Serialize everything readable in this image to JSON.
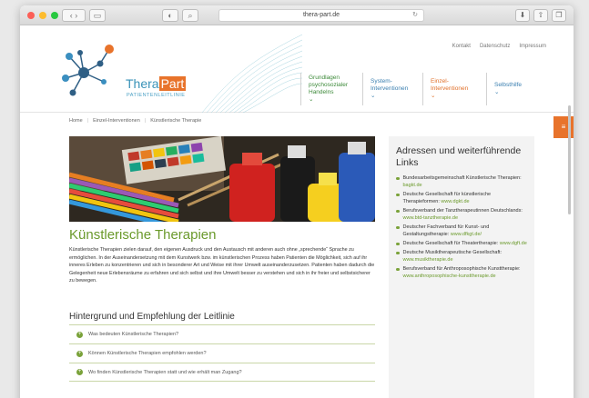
{
  "browser": {
    "url": "thera-part.de"
  },
  "logo": {
    "brand_prefix": "Thera",
    "brand_suffix": "Part",
    "tagline": "PATIENTENLEITLINIE"
  },
  "meta_nav": [
    "Kontakt",
    "Datenschutz",
    "Impressum"
  ],
  "main_nav": [
    {
      "label": "Grundlagen psychosozialer Handelns",
      "color": "green"
    },
    {
      "label": "System-Interventionen",
      "color": "blue"
    },
    {
      "label": "Einzel-Interventionen",
      "color": "orange"
    },
    {
      "label": "Selbsthilfe",
      "color": "blue"
    }
  ],
  "breadcrumb": [
    "Home",
    "Einzel-Interventionen",
    "Künstlerische Therapie"
  ],
  "main": {
    "title": "Künstlerische Therapien",
    "intro": "Künstlerische Therapien zielen darauf, den eigenen Ausdruck und den Austausch mit anderen auch ohne „sprechende“ Sprache zu ermöglichen. In der Auseinandersetzung mit dem Kunstwerk bzw. im künstlerischen Prozess haben Patienten die Möglichkeit, sich auf ihr inneres Erleben zu konzentrieren und sich in besonderer Art und Weise mit ihrer Umwelt auseinanderzusetzen. Patienten haben dadurch die Gelegenheit neue Erlebensräume zu erfahren und sich selbst und ihre Umwelt besser zu verstehen und sich in ihr freier und selbstsicherer zu bewegen.",
    "subheading": "Hintergrund und Empfehlung der Leitlinie",
    "faq": [
      "Was bedeuten Künstlerische Therapien?",
      "Können Künstlerische Therapien empfohlen werden?",
      "Wo finden Künstlerische Therapien statt und wie erhält man Zugang?"
    ]
  },
  "sidebar": {
    "title": "Adressen und weiterführende Links",
    "links": [
      {
        "text": "Bundesarbeitsgemeinschaft Künstlerische Therapien:",
        "link": "bagkt.de"
      },
      {
        "text": "Deutsche Gesellschaft für künstlerische Therapieformen:",
        "link": "www.dgkt.de"
      },
      {
        "text": "Berufsverband der Tanztherapeutinnen Deutschlands:",
        "link": "www.btd-tanztherapie.de"
      },
      {
        "text": "Deutscher Fachverband für Kunst- und Gestaltungstherapie:",
        "link": "www.dfkgt.de/"
      },
      {
        "text": "Deutsche Gesellschaft für Theatertherapie:",
        "link": "www.dgft.de"
      },
      {
        "text": "Deutsche Musiktherapeutische Gesellschaft:",
        "link": "www.musiktherapie.de"
      },
      {
        "text": "Berufsverband für Anthroposophische Kunsttherapie:",
        "link": "www.anthroposophische-kunsttherapie.de"
      }
    ]
  },
  "colors": {
    "green": "#6b9a2c",
    "orange": "#e8732b",
    "blue": "#3a7fb0"
  }
}
